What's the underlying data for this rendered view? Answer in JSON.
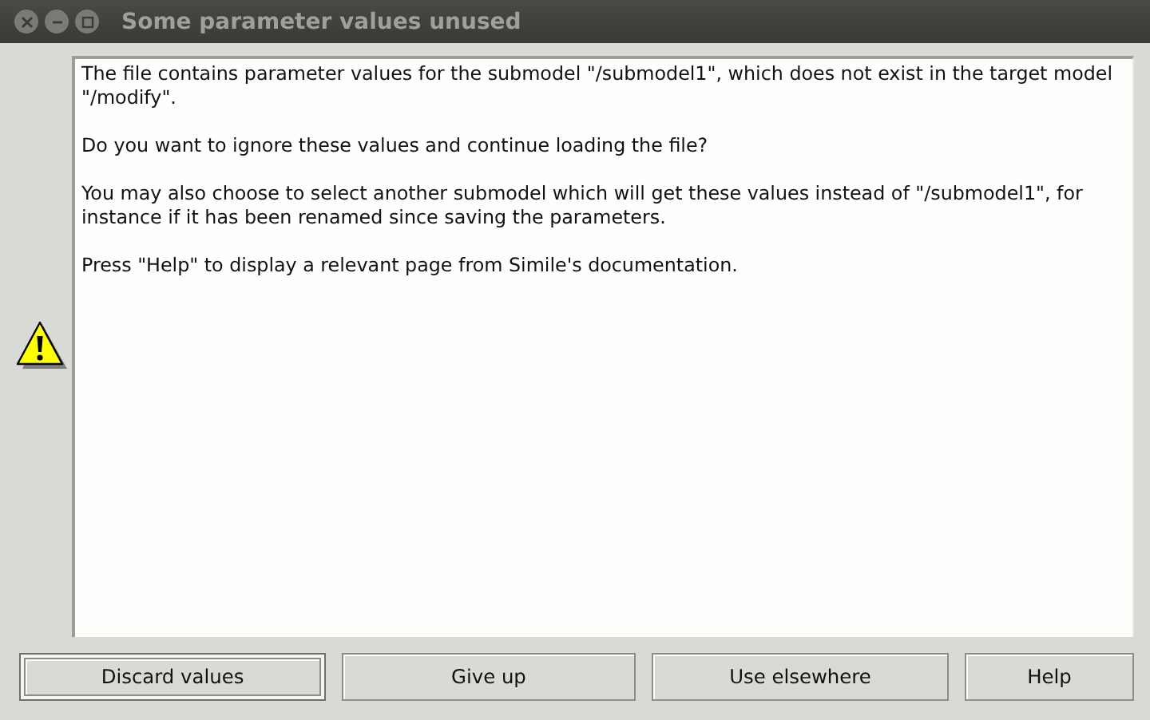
{
  "window": {
    "title": "Some parameter values unused"
  },
  "message": [
    "The file contains parameter values for the submodel \"/submodel1\", which does not exist in the target model \"/modify\".",
    "Do you want to ignore these values and continue loading the file?",
    "You may also choose to select another submodel which will get these values instead of \"/submodel1\", for instance if it has been renamed since saving the parameters.",
    "Press \"Help\" to display a relevant page from Simile's documentation."
  ],
  "buttons": [
    {
      "label": "Discard values",
      "focused": true
    },
    {
      "label": "Give up",
      "focused": false
    },
    {
      "label": "Use elsewhere",
      "focused": false
    },
    {
      "label": "Help",
      "focused": false
    }
  ]
}
